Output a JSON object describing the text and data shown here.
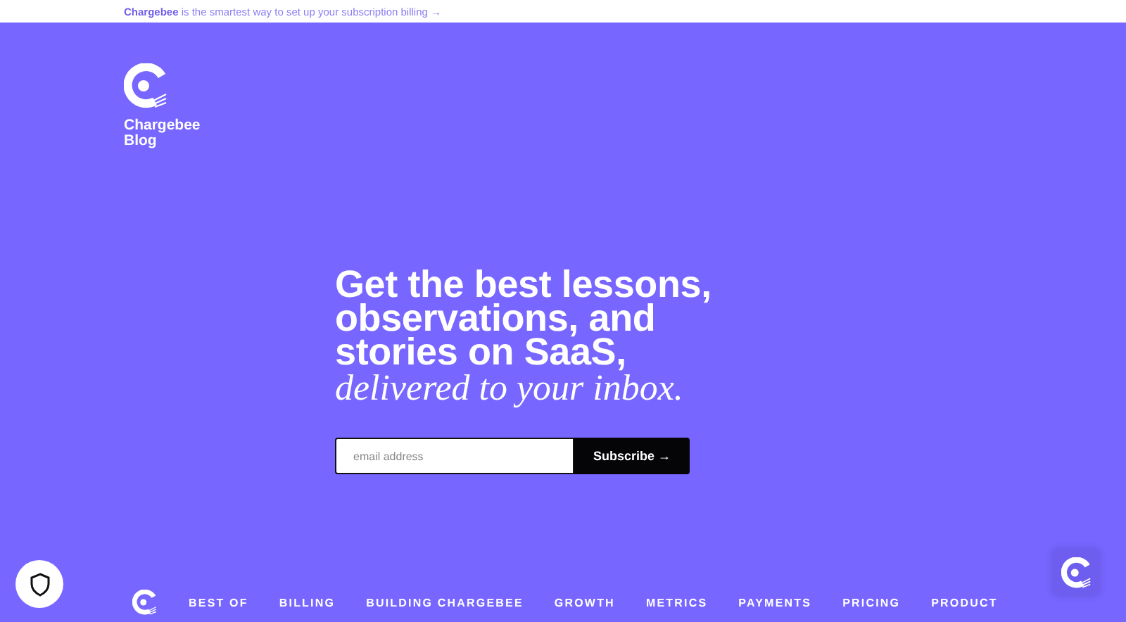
{
  "banner": {
    "text": "**Chargebee** is the smartest way to set up your subscription billing →"
  },
  "brand": {
    "name": "Chargebee",
    "subtitle": "Blog"
  },
  "hero": {
    "headline_lines": [
      "Get the best lessons,",
      "observations, and",
      "stories on SaaS,"
    ],
    "tagline": "delivered to your inbox."
  },
  "subscribe": {
    "placeholder": "email address",
    "button": "Subscribe →"
  },
  "nav": {
    "items": [
      {
        "label": "BEST OF"
      },
      {
        "label": "BILLING"
      },
      {
        "label": "BUILDING CHARGEBEE"
      },
      {
        "label": "GROWTH"
      },
      {
        "label": "METRICS"
      },
      {
        "label": "PAYMENTS"
      },
      {
        "label": "PRICING"
      },
      {
        "label": "PRODUCT"
      }
    ]
  }
}
